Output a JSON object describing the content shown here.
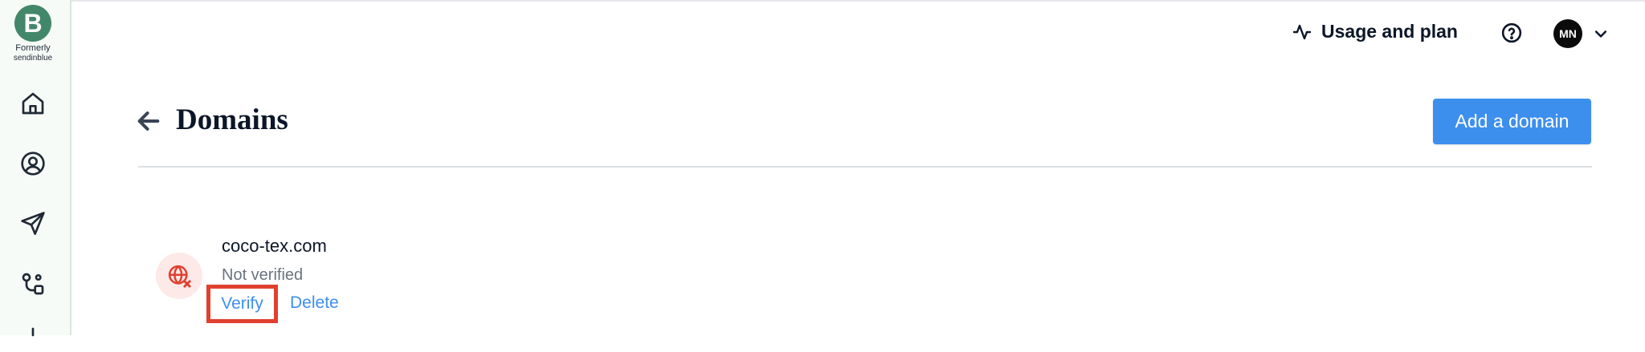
{
  "brand": {
    "logo_letter": "B",
    "formerly_line1": "Formerly",
    "formerly_line2": "sendinblue",
    "color": "#43876a"
  },
  "sidebar": {
    "items": [
      {
        "icon": "home-icon"
      },
      {
        "icon": "contacts-icon"
      },
      {
        "icon": "campaigns-send-icon"
      },
      {
        "icon": "automations-icon"
      },
      {
        "icon": "more-icon"
      }
    ]
  },
  "header": {
    "usage_label": "Usage and plan",
    "usage_icon": "activity-icon",
    "help_icon": "help-circle-icon",
    "avatar_initials": "MN",
    "dropdown_icon": "chevron-down-icon"
  },
  "page": {
    "back_icon": "arrow-left-icon",
    "title": "Domains",
    "add_button_label": "Add a domain",
    "accent_color": "#3d8fee"
  },
  "domains": [
    {
      "name": "coco-tex.com",
      "status": "Not verified",
      "icon": "globe-error-icon",
      "actions": {
        "verify": "Verify",
        "delete": "Delete"
      }
    }
  ]
}
